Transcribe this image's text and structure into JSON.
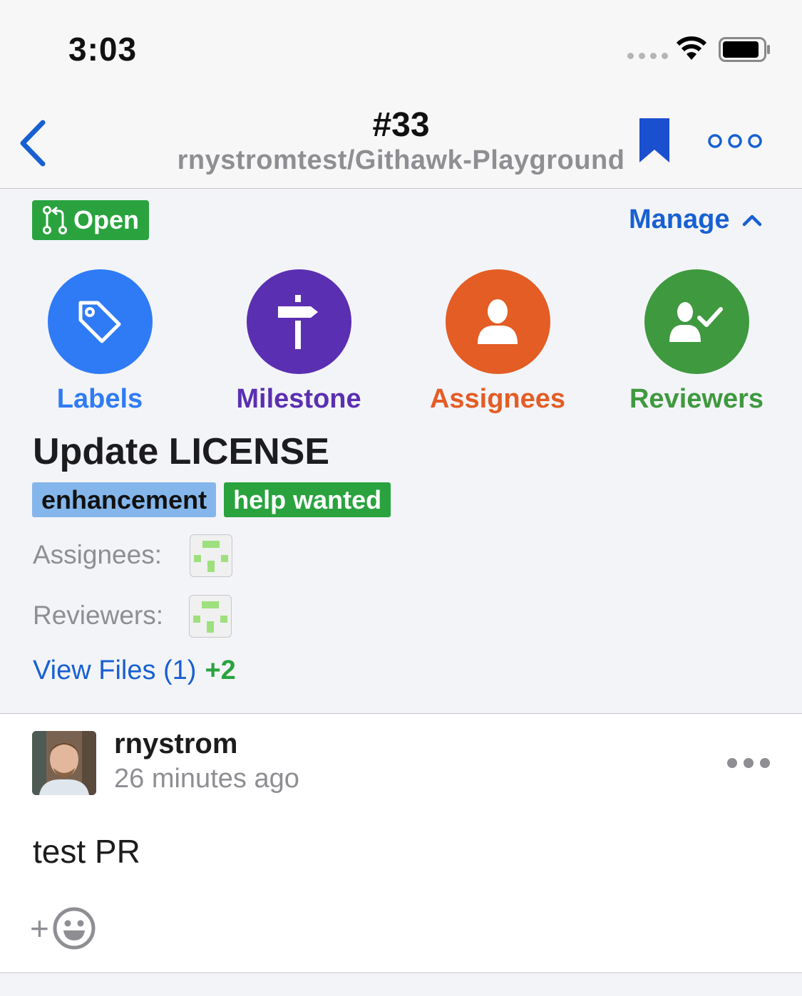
{
  "status_bar": {
    "time": "3:03"
  },
  "nav": {
    "title": "#33",
    "subtitle": "rnystromtest/Githawk-Playground"
  },
  "state": {
    "label": "Open",
    "color": "#2aa33f"
  },
  "manage": {
    "label": "Manage"
  },
  "actions": [
    {
      "label": "Labels",
      "color": "#2f7bf5",
      "icon": "tag-icon"
    },
    {
      "label": "Milestone",
      "color": "#5b2fb1",
      "icon": "signpost-icon"
    },
    {
      "label": "Assignees",
      "color": "#e35d25",
      "icon": "person-icon"
    },
    {
      "label": "Reviewers",
      "color": "#3f993f",
      "icon": "person-check-icon"
    }
  ],
  "pr": {
    "title": "Update LICENSE",
    "labels": [
      {
        "name": "enhancement",
        "color": "#84b6eb"
      },
      {
        "name": "help wanted",
        "color": "#2aa33f"
      }
    ],
    "assignees_label": "Assignees:",
    "reviewers_label": "Reviewers:",
    "view_files": "View Files (1)",
    "additions": "+2"
  },
  "comment": {
    "author": "rnystrom",
    "time_ago": "26 minutes ago",
    "body": "test PR",
    "reaction_add": "+"
  }
}
